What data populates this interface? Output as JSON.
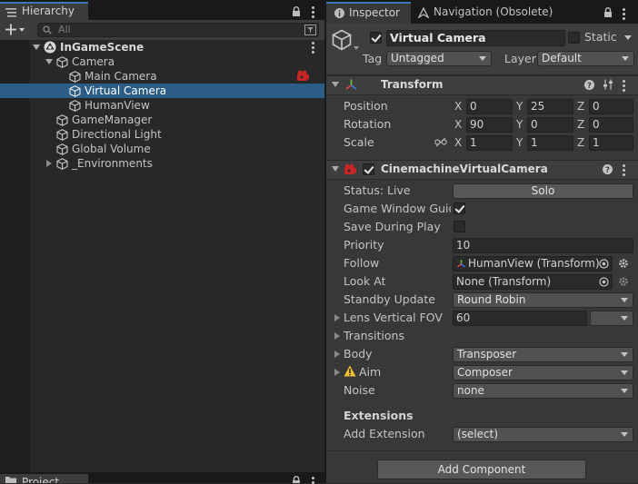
{
  "hierarchy": {
    "tab_label": "Hierarchy",
    "search_placeholder": "All",
    "scene": "InGameScene",
    "items": [
      {
        "label": "Camera"
      },
      {
        "label": "Main Camera"
      },
      {
        "label": "Virtual Camera"
      },
      {
        "label": "HumanView"
      },
      {
        "label": "GameManager"
      },
      {
        "label": "Directional Light"
      },
      {
        "label": "Global Volume"
      },
      {
        "label": "_Environments"
      }
    ],
    "bottom_tab": "Project"
  },
  "inspector": {
    "tabs": [
      {
        "label": "Inspector"
      },
      {
        "label": "Navigation (Obsolete)"
      }
    ],
    "object_name": "Virtual Camera",
    "static_label": "Static",
    "tag_label": "Tag",
    "tag_value": "Untagged",
    "layer_label": "Layer",
    "layer_value": "Default",
    "transform": {
      "title": "Transform",
      "position": {
        "label": "Position",
        "x": "0",
        "y": "25",
        "z": "0"
      },
      "rotation": {
        "label": "Rotation",
        "x": "90",
        "y": "0",
        "z": "0"
      },
      "scale": {
        "label": "Scale",
        "x": "1",
        "y": "1",
        "z": "1"
      },
      "axis_x": "X",
      "axis_y": "Y",
      "axis_z": "Z"
    },
    "cinemachine": {
      "title": "CinemachineVirtualCamera",
      "status_label": "Status: Live",
      "solo_label": "Solo",
      "game_window_guides_label": "Game Window Guides",
      "save_during_play_label": "Save During Play",
      "priority_label": "Priority",
      "priority_value": "10",
      "follow_label": "Follow",
      "follow_value": "HumanView (Transform)",
      "look_at_label": "Look At",
      "look_at_value": "None (Transform)",
      "standby_label": "Standby Update",
      "standby_value": "Round Robin",
      "lens_label": "Lens Vertical FOV",
      "lens_value": "60",
      "transitions_label": "Transitions",
      "body_label": "Body",
      "body_value": "Transposer",
      "aim_label": "Aim",
      "aim_value": "Composer",
      "noise_label": "Noise",
      "noise_value": "none",
      "extensions_label": "Extensions",
      "add_extension_label": "Add Extension",
      "add_extension_value": "(select)"
    },
    "add_component_label": "Add Component"
  },
  "colors": {
    "selection": "#2c5d87",
    "tab_accent": "#3a79bb",
    "warning": "#f2c12e",
    "cinemachine_red": "#d42a2a"
  }
}
